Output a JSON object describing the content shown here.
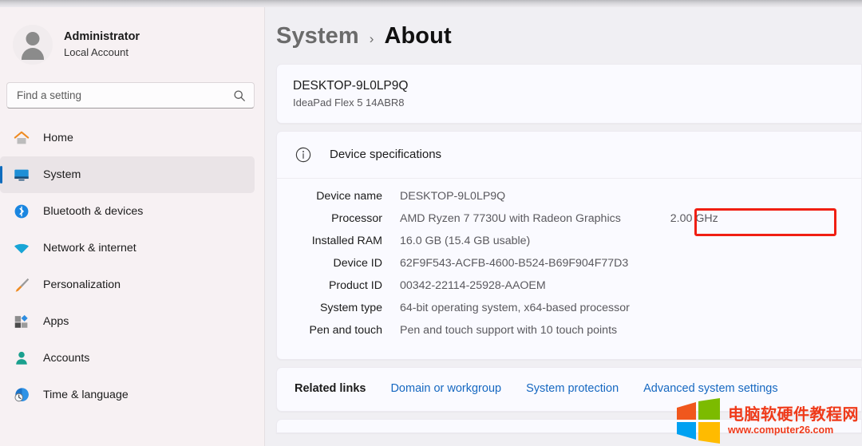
{
  "sidebar": {
    "profile": {
      "name": "Administrator",
      "account_type": "Local Account",
      "avatar_icon": "person-avatar"
    },
    "search": {
      "placeholder": "Find a setting",
      "value": "",
      "icon": "search-icon"
    },
    "items": [
      {
        "label": "Home",
        "icon": "home-icon",
        "selected": false
      },
      {
        "label": "System",
        "icon": "monitor-icon",
        "selected": true
      },
      {
        "label": "Bluetooth & devices",
        "icon": "bluetooth-icon",
        "selected": false
      },
      {
        "label": "Network & internet",
        "icon": "wifi-icon",
        "selected": false
      },
      {
        "label": "Personalization",
        "icon": "paintbrush-icon",
        "selected": false
      },
      {
        "label": "Apps",
        "icon": "apps-icon",
        "selected": false
      },
      {
        "label": "Accounts",
        "icon": "accounts-person-icon",
        "selected": false
      },
      {
        "label": "Time & language",
        "icon": "clock-globe-icon",
        "selected": false
      }
    ]
  },
  "breadcrumb": {
    "parent": "System",
    "separator": "›",
    "current": "About"
  },
  "device_card": {
    "name": "DESKTOP-9L0LP9Q",
    "model": "IdeaPad Flex 5 14ABR8"
  },
  "device_specifications": {
    "section_title": "Device specifications",
    "section_icon": "info-circle-icon",
    "rows": [
      {
        "key": "Device name",
        "value": "DESKTOP-9L0LP9Q",
        "extra": "",
        "highlighted": true
      },
      {
        "key": "Processor",
        "value": "AMD Ryzen 7 7730U with Radeon Graphics",
        "extra": "2.00 GHz",
        "highlighted": false
      },
      {
        "key": "Installed RAM",
        "value": "16.0 GB (15.4 GB usable)",
        "extra": "",
        "highlighted": false
      },
      {
        "key": "Device ID",
        "value": "62F9F543-ACFB-4600-B524-B69F904F77D3",
        "extra": "",
        "highlighted": false
      },
      {
        "key": "Product ID",
        "value": "00342-22114-25928-AAOEM",
        "extra": "",
        "highlighted": false
      },
      {
        "key": "System type",
        "value": "64-bit operating system, x64-based processor",
        "extra": "",
        "highlighted": false
      },
      {
        "key": "Pen and touch",
        "value": "Pen and touch support with 10 touch points",
        "extra": "",
        "highlighted": false
      }
    ]
  },
  "related_links": {
    "label": "Related links",
    "links": [
      "Domain or workgroup",
      "System protection",
      "Advanced system settings"
    ]
  },
  "watermark": {
    "title": "电脑软硬件教程网",
    "url": "www.computer26.com",
    "logo_icon": "windows-logo-icon"
  },
  "colors": {
    "accent": "#0f6cbd",
    "link": "#1668c1",
    "annotation": "#f01f13",
    "watermark": "#ef3a1a"
  }
}
